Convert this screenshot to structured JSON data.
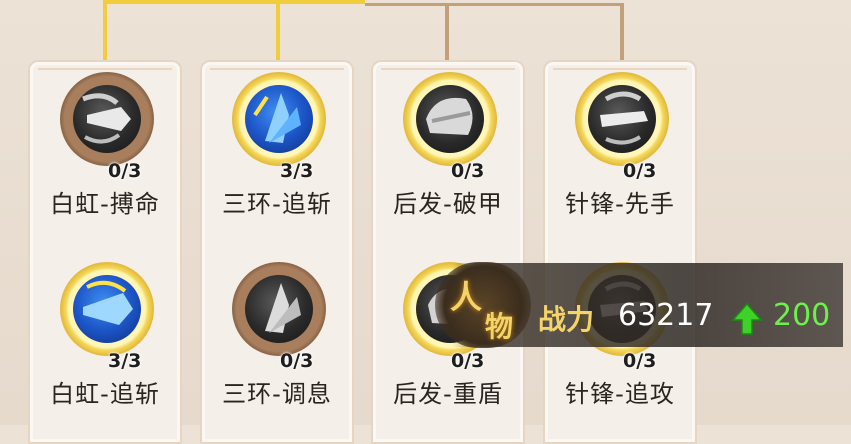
{
  "skills": [
    {
      "label": "白虹-搏命",
      "count": "0/3",
      "icon": "sword-stab-icon"
    },
    {
      "label": "三环-追斩",
      "count": "3/3",
      "icon": "blue-blade-icon"
    },
    {
      "label": "后发-破甲",
      "count": "0/3",
      "icon": "armor-break-icon"
    },
    {
      "label": "针锋-先手",
      "count": "0/3",
      "icon": "strike-first-icon"
    },
    {
      "label": "白虹-追斩",
      "count": "3/3",
      "icon": "blue-slash-icon"
    },
    {
      "label": "三环-调息",
      "count": "0/3",
      "icon": "ring-breath-icon"
    },
    {
      "label": "后发-重盾",
      "count": "0/3",
      "icon": "heavy-shield-icon"
    },
    {
      "label": "针锋-追攻",
      "count": "0/3",
      "icon": "pursuit-attack-icon"
    }
  ],
  "power_popup": {
    "badge_char_1": "人",
    "badge_char_2": "物",
    "label": "战力",
    "value": "63217",
    "delta": "200",
    "arrow_icon": "up-arrow-icon"
  },
  "colors": {
    "gold_line": "#f1cd3b",
    "brown_line": "#c3a07a",
    "delta_green": "#6bf24a",
    "label_gold": "#f5d56a"
  }
}
